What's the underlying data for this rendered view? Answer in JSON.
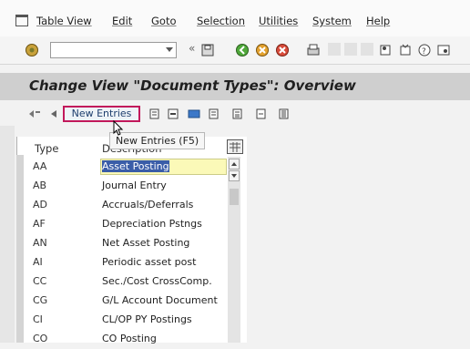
{
  "menu": {
    "items": [
      "Table View",
      "Edit",
      "Goto",
      "Selection",
      "Utilities",
      "System",
      "Help"
    ]
  },
  "toolbar": {
    "command_field_value": "",
    "enter_icon": "enter-icon",
    "save_icon": "save-icon",
    "back_icon": "back-icon",
    "exit_icon": "exit-icon",
    "cancel_icon": "cancel-icon",
    "print_icon": "print-icon"
  },
  "title": "Change View \"Document Types\": Overview",
  "app_toolbar": {
    "new_entries_label": "New Entries",
    "tooltip": "New Entries   (F5)"
  },
  "table": {
    "columns": [
      "Type",
      "Description"
    ],
    "rows": [
      {
        "type": "AA",
        "desc": "Asset Posting",
        "selected": true
      },
      {
        "type": "AB",
        "desc": "Journal Entry"
      },
      {
        "type": "AD",
        "desc": "Accruals/Deferrals"
      },
      {
        "type": "AF",
        "desc": "Depreciation Pstngs"
      },
      {
        "type": "AN",
        "desc": "Net Asset Posting"
      },
      {
        "type": "AI",
        "desc": "Periodic asset post"
      },
      {
        "type": "CC",
        "desc": "Sec./Cost CrossComp."
      },
      {
        "type": "CG",
        "desc": "G/L Account Document"
      },
      {
        "type": "CI",
        "desc": "CL/OP PY Postings"
      },
      {
        "type": "CO",
        "desc": "CO Posting"
      }
    ]
  },
  "colors": {
    "highlight_border": "#c2185b",
    "selection": "#3a5da8",
    "selected_cell_bg": "#fbf9b8"
  }
}
